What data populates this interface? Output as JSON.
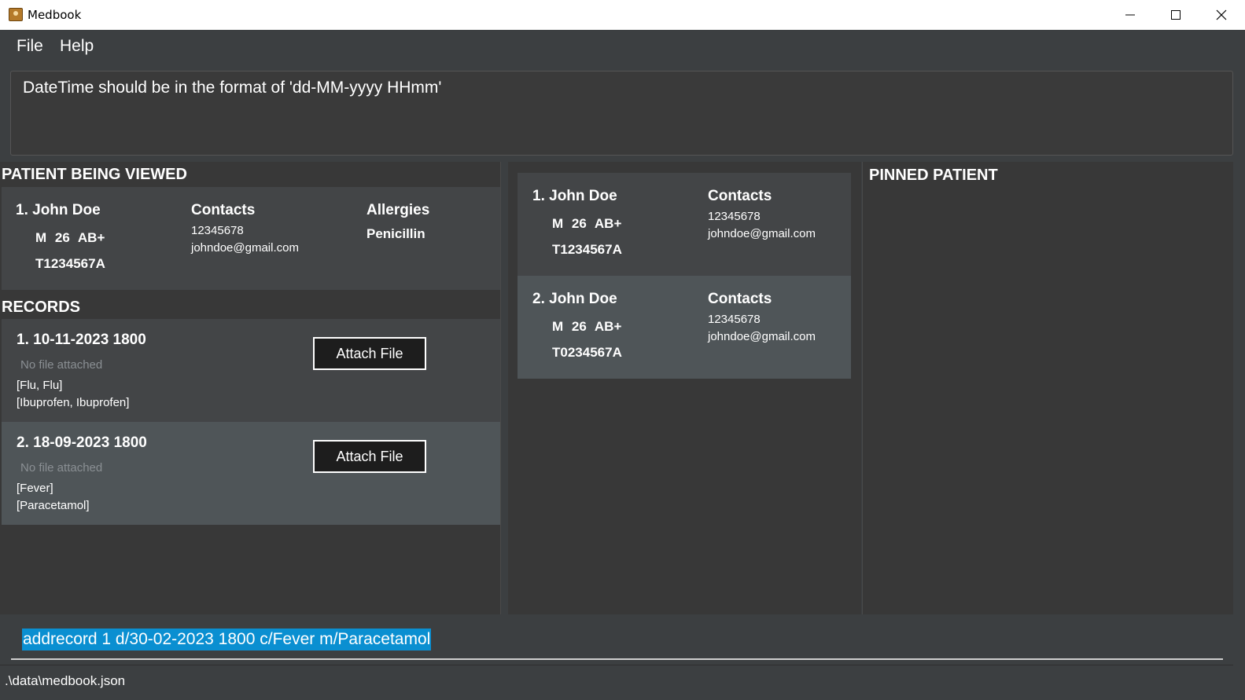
{
  "window": {
    "title": "Medbook"
  },
  "menu": {
    "file": "File",
    "help": "Help"
  },
  "result_display": {
    "message": "DateTime should be in the format of 'dd-MM-yyyy HHmm'"
  },
  "viewed": {
    "header": "PATIENT BEING VIEWED",
    "patient": {
      "name": "1. John Doe",
      "details": "M 26 AB+",
      "nric": "T1234567A",
      "contacts_label": "Contacts",
      "phone": "12345678",
      "email": "johndoe@gmail.com",
      "allergies_label": "Allergies",
      "allergies": "Penicillin"
    }
  },
  "records": {
    "header": "RECORDS",
    "items": [
      {
        "date": "1. 10-11-2023 1800",
        "file": "No file attached",
        "conditions": "[Flu, Flu]",
        "medications": "[Ibuprofen, Ibuprofen]",
        "button": "Attach File"
      },
      {
        "date": "2. 18-09-2023 1800",
        "file": "No file attached",
        "conditions": "[Fever]",
        "medications": "[Paracetamol]",
        "button": "Attach File"
      }
    ]
  },
  "patient_list": [
    {
      "name": "1. John Doe",
      "details": "M 26 AB+",
      "nric": "T1234567A",
      "contacts_label": "Contacts",
      "phone": "12345678",
      "email": "johndoe@gmail.com"
    },
    {
      "name": "2. John Doe",
      "details": "M 26 AB+",
      "nric": "T0234567A",
      "contacts_label": "Contacts",
      "phone": "12345678",
      "email": "johndoe@gmail.com"
    }
  ],
  "pinned": {
    "header": "PINNED PATIENT"
  },
  "command": {
    "value": "addrecord 1 d/30-02-2023 1800 c/Fever m/Paracetamol"
  },
  "status": {
    "path": ".\\data\\medbook.json"
  },
  "colors": {
    "background": "#3c3f41",
    "card": "#434547",
    "card_selected": "#4f5558",
    "selection": "#0a8fd1"
  }
}
